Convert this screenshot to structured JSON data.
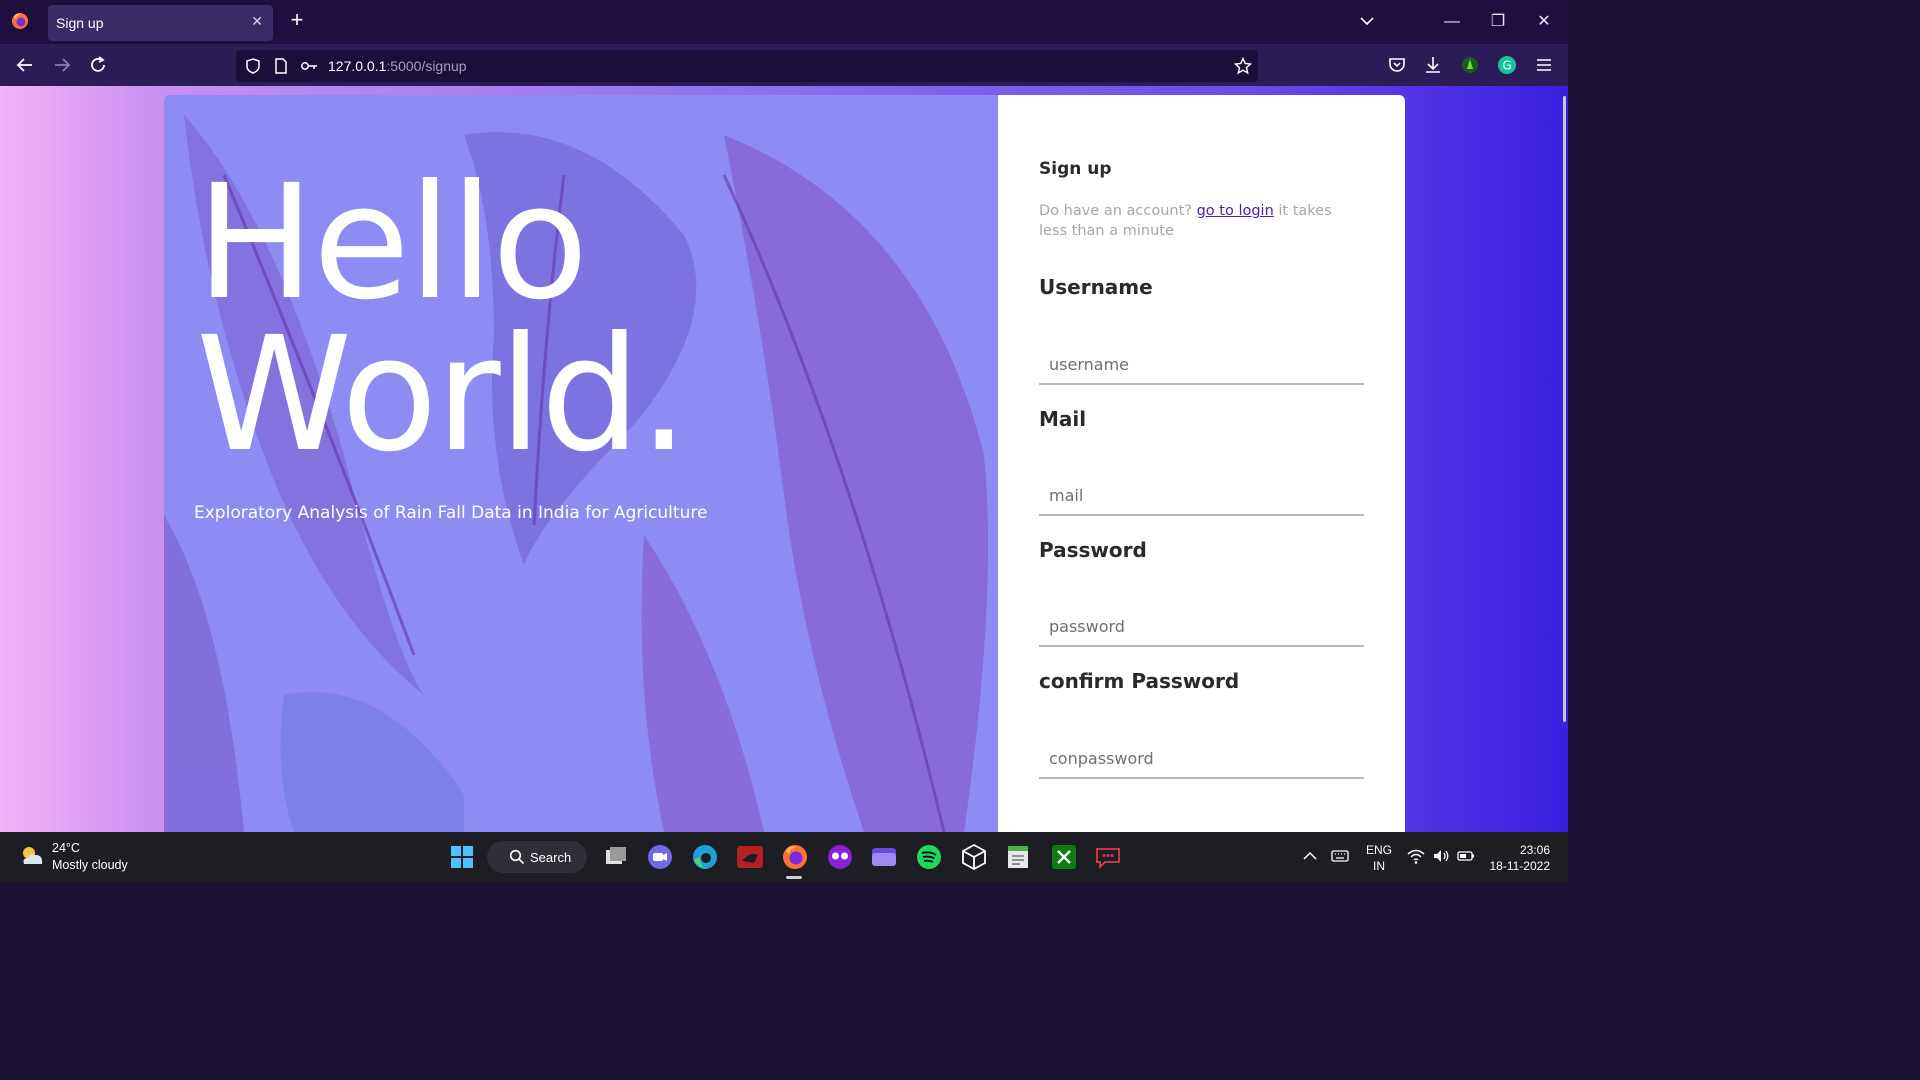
{
  "browser": {
    "tab_title": "Sign up",
    "url_host": "127.0.0.1",
    "url_path": ":5000/signup"
  },
  "hero": {
    "line1": "Hello",
    "line2": "World.",
    "subtitle": "Exploratory Analysis of Rain Fall Data in India for Agriculture"
  },
  "form": {
    "heading": "Sign up",
    "prompt_before": "Do have an account? ",
    "login_link": "go to login",
    "prompt_after": " it takes less than a minute",
    "username_label": "Username",
    "username_placeholder": "username",
    "mail_label": "Mail",
    "mail_placeholder": "mail",
    "password_label": "Password",
    "password_placeholder": "password",
    "confirm_label": "confirm Password",
    "confirm_placeholder": "conpassword"
  },
  "taskbar": {
    "temperature": "24°C",
    "weather": "Mostly cloudy",
    "search_label": "Search",
    "lang_line1": "ENG",
    "lang_line2": "IN",
    "time": "23:06",
    "date": "18-11-2022",
    "apps": [
      "windows-start-icon",
      "task-view-icon",
      "zoom-icon",
      "edge-icon",
      "xampp-icon",
      "firefox-icon",
      "app-mask-icon",
      "folder-app-icon",
      "spotify-icon",
      "unity-icon",
      "notepad-icon",
      "xbox-icon",
      "chat-icon"
    ]
  },
  "colors": {
    "panel_purple": "#8e8cf2",
    "link": "#4a1ea8",
    "chrome_dark": "#1f0f3f"
  }
}
